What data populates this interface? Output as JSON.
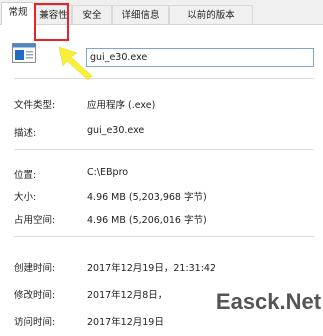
{
  "tabs": [
    {
      "label": "常规",
      "active": true
    },
    {
      "label": "兼容性",
      "active": false
    },
    {
      "label": "安全",
      "active": false
    },
    {
      "label": "详细信息",
      "active": false
    },
    {
      "label": "以前的版本",
      "active": false
    }
  ],
  "file": {
    "name": "gui_e30.exe",
    "icon": "exe-file-icon"
  },
  "props": {
    "type_label": "文件类型:",
    "type_value": "应用程序 (.exe)",
    "desc_label": "描述:",
    "desc_value": "gui_e30.exe",
    "loc_label": "位置:",
    "loc_value": "C:\\EBpro",
    "size_label": "大小:",
    "size_value": "4.96 MB (5,203,968 字节)",
    "disk_label": "占用空间:",
    "disk_value": "4.96 MB (5,206,016 字节)",
    "created_label": "创建时间:",
    "created_value": "2017年12月19日，21:31:42",
    "modified_label": "修改时间:",
    "modified_value": "2017年12月8日，",
    "accessed_label": "访问时间:",
    "accessed_value": "2017年12月19日"
  },
  "annotation": {
    "box_color": "#e8242a",
    "arrow_color": "#f7ef3a"
  },
  "watermark": {
    "text": "Easck.Net"
  }
}
